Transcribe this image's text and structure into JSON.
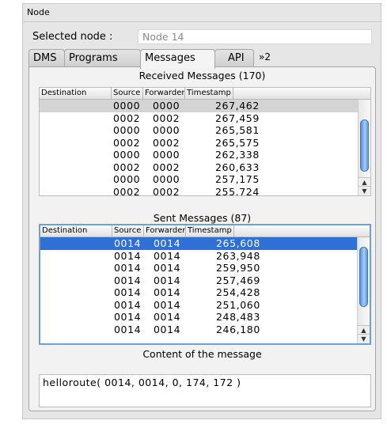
{
  "panel": {
    "title": "Node",
    "selected_label": "Selected node :",
    "selected_value": "Node 14"
  },
  "tabs": [
    {
      "label": "DMS",
      "active": false
    },
    {
      "label": "Programs",
      "active": false
    },
    {
      "label": "Messages",
      "active": true
    },
    {
      "label": "API",
      "active": false
    }
  ],
  "more_tabs": {
    "label": "»2"
  },
  "columns": [
    "Destination",
    "Source",
    "Forwarder",
    "Timestamp"
  ],
  "received": {
    "title": "Received Messages (170)",
    "rows": [
      {
        "destination": "",
        "source": "0000",
        "forwarder": "0000",
        "timestamp": "267,462"
      },
      {
        "destination": "",
        "source": "0002",
        "forwarder": "0002",
        "timestamp": "267,459"
      },
      {
        "destination": "",
        "source": "0000",
        "forwarder": "0000",
        "timestamp": "265,581"
      },
      {
        "destination": "",
        "source": "0002",
        "forwarder": "0002",
        "timestamp": "265,575"
      },
      {
        "destination": "",
        "source": "0000",
        "forwarder": "0000",
        "timestamp": "262,338"
      },
      {
        "destination": "",
        "source": "0002",
        "forwarder": "0002",
        "timestamp": "260,633"
      },
      {
        "destination": "",
        "source": "0000",
        "forwarder": "0000",
        "timestamp": "257,175"
      },
      {
        "destination": "",
        "source": "0002",
        "forwarder": "0002",
        "timestamp": "255,724"
      }
    ]
  },
  "sent": {
    "title": "Sent Messages (87)",
    "rows": [
      {
        "destination": "",
        "source": "0014",
        "forwarder": "0014",
        "timestamp": "265,608"
      },
      {
        "destination": "",
        "source": "0014",
        "forwarder": "0014",
        "timestamp": "263,948"
      },
      {
        "destination": "",
        "source": "0014",
        "forwarder": "0014",
        "timestamp": "259,950"
      },
      {
        "destination": "",
        "source": "0014",
        "forwarder": "0014",
        "timestamp": "257,469"
      },
      {
        "destination": "",
        "source": "0014",
        "forwarder": "0014",
        "timestamp": "254,428"
      },
      {
        "destination": "",
        "source": "0014",
        "forwarder": "0014",
        "timestamp": "251,060"
      },
      {
        "destination": "",
        "source": "0014",
        "forwarder": "0014",
        "timestamp": "248,483"
      },
      {
        "destination": "",
        "source": "0014",
        "forwarder": "0014",
        "timestamp": "246,180"
      }
    ]
  },
  "message": {
    "title": "Content of the message",
    "text": "helloroute( 0014, 0014, 0, 174, 172 )"
  },
  "scroll": {
    "up_icon": "▲",
    "down_icon": "▼"
  },
  "colors": {
    "selection": "#2f70d6",
    "focus_border": "#6f9fd4",
    "scroll_thumb": "#4e8fe0"
  }
}
